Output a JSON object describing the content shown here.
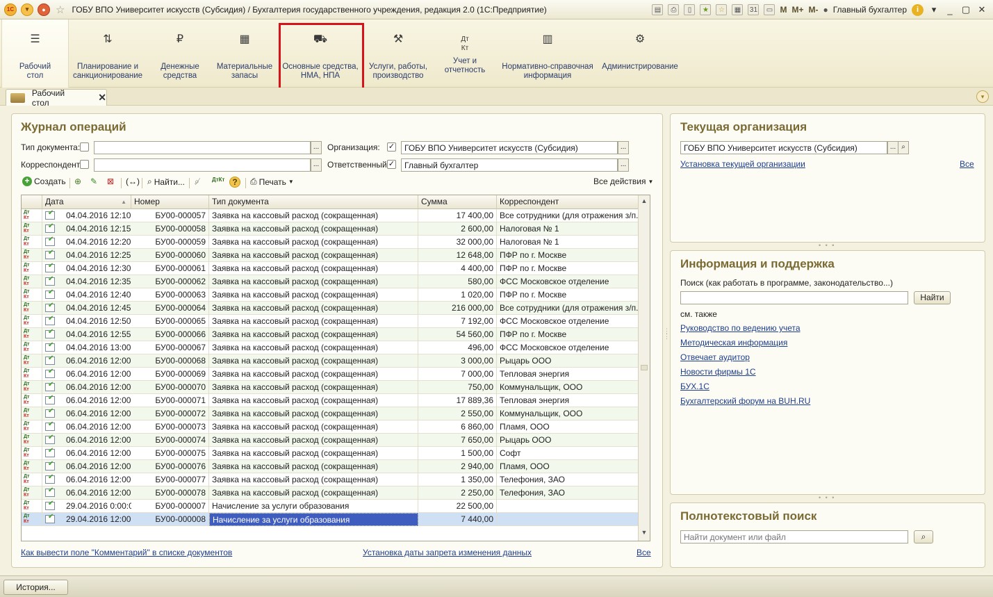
{
  "window": {
    "title": "ГОБУ ВПО Университет искусств (Субсидия) / Бухгалтерия государственного учреждения, редакция 2.0  (1С:Предприятие)",
    "logo_text": "1С",
    "mem_m": "M",
    "mem_mplus": "M+",
    "mem_mminus": "M-",
    "user": "Главный бухгалтер",
    "calendar_day": "31"
  },
  "sections": [
    {
      "label": "Рабочий\nстол",
      "icon": "menu-icon"
    },
    {
      "label": "Планирование и\nсанкционирование",
      "icon": "planning-icon"
    },
    {
      "label": "Денежные\nсредства",
      "icon": "money-icon"
    },
    {
      "label": "Материальные\nзапасы",
      "icon": "grid-icon"
    },
    {
      "label": "Основные средства,\nНМА, НПА",
      "icon": "truck-icon"
    },
    {
      "label": "Услуги, работы,\nпроизводство",
      "icon": "tools-icon"
    },
    {
      "label": "Учет и\nотчетность",
      "icon": "dtkt-icon"
    },
    {
      "label": "Нормативно-справочная\nинформация",
      "icon": "books-icon"
    },
    {
      "label": "Администрирование",
      "icon": "gear-icon"
    }
  ],
  "tab": {
    "label": "Рабочий стол"
  },
  "journal": {
    "title": "Журнал операций",
    "doc_type_label": "Тип документа:",
    "doc_type_value": "",
    "correspondent_label": "Корреспондент:",
    "correspondent_value": "",
    "org_label": "Организация:",
    "org_value": "ГОБУ ВПО Университет искусств (Субсидия)",
    "resp_label": "Ответственный:",
    "resp_value": "Главный бухгалтер",
    "toolbar": {
      "create": "Создать",
      "find": "Найти...",
      "print": "Печать",
      "all_actions": "Все действия"
    },
    "columns": [
      "Дата",
      "Номер",
      "Тип документа",
      "Сумма",
      "Корреспондент"
    ],
    "rows": [
      [
        "04.04.2016 12:10:00",
        "БУ00-000057",
        "Заявка на кассовый расход (сокращенная)",
        "17 400,00",
        "Все сотрудники (для отражения з/п..."
      ],
      [
        "04.04.2016 12:15:00",
        "БУ00-000058",
        "Заявка на кассовый расход (сокращенная)",
        "2 600,00",
        "Налоговая № 1"
      ],
      [
        "04.04.2016 12:20:00",
        "БУ00-000059",
        "Заявка на кассовый расход (сокращенная)",
        "32 000,00",
        "Налоговая № 1"
      ],
      [
        "04.04.2016 12:25:00",
        "БУ00-000060",
        "Заявка на кассовый расход (сокращенная)",
        "12 648,00",
        "ПФР по г. Москве"
      ],
      [
        "04.04.2016 12:30:00",
        "БУ00-000061",
        "Заявка на кассовый расход (сокращенная)",
        "4 400,00",
        "ПФР по г. Москве"
      ],
      [
        "04.04.2016 12:35:00",
        "БУ00-000062",
        "Заявка на кассовый расход (сокращенная)",
        "580,00",
        "ФСС Московское отделение"
      ],
      [
        "04.04.2016 12:40:00",
        "БУ00-000063",
        "Заявка на кассовый расход (сокращенная)",
        "1 020,00",
        "ПФР по г. Москве"
      ],
      [
        "04.04.2016 12:45:00",
        "БУ00-000064",
        "Заявка на кассовый расход (сокращенная)",
        "216 000,00",
        "Все сотрудники (для отражения з/п..."
      ],
      [
        "04.04.2016 12:50:00",
        "БУ00-000065",
        "Заявка на кассовый расход (сокращенная)",
        "7 192,00",
        "ФСС Московское отделение"
      ],
      [
        "04.04.2016 12:55:00",
        "БУ00-000066",
        "Заявка на кассовый расход (сокращенная)",
        "54 560,00",
        "ПФР по г. Москве"
      ],
      [
        "04.04.2016 13:00:00",
        "БУ00-000067",
        "Заявка на кассовый расход (сокращенная)",
        "496,00",
        "ФСС Московское отделение"
      ],
      [
        "06.04.2016 12:00:00",
        "БУ00-000068",
        "Заявка на кассовый расход (сокращенная)",
        "3 000,00",
        "Рыцарь ООО"
      ],
      [
        "06.04.2016 12:00:01",
        "БУ00-000069",
        "Заявка на кассовый расход (сокращенная)",
        "7 000,00",
        "Тепловая энергия"
      ],
      [
        "06.04.2016 12:00:02",
        "БУ00-000070",
        "Заявка на кассовый расход (сокращенная)",
        "750,00",
        "Коммунальщик, ООО"
      ],
      [
        "06.04.2016 12:00:03",
        "БУ00-000071",
        "Заявка на кассовый расход (сокращенная)",
        "17 889,36",
        "Тепловая энергия"
      ],
      [
        "06.04.2016 12:00:04",
        "БУ00-000072",
        "Заявка на кассовый расход (сокращенная)",
        "2 550,00",
        "Коммунальщик, ООО"
      ],
      [
        "06.04.2016 12:00:05",
        "БУ00-000073",
        "Заявка на кассовый расход (сокращенная)",
        "6 860,00",
        "Пламя, ООО"
      ],
      [
        "06.04.2016 12:00:06",
        "БУ00-000074",
        "Заявка на кассовый расход (сокращенная)",
        "7 650,00",
        "Рыцарь ООО"
      ],
      [
        "06.04.2016 12:00:07",
        "БУ00-000075",
        "Заявка на кассовый расход (сокращенная)",
        "1 500,00",
        "Софт"
      ],
      [
        "06.04.2016 12:00:08",
        "БУ00-000076",
        "Заявка на кассовый расход (сокращенная)",
        "2 940,00",
        "Пламя, ООО"
      ],
      [
        "06.04.2016 12:00:09",
        "БУ00-000077",
        "Заявка на кассовый расход (сокращенная)",
        "1 350,00",
        "Телефония, ЗАО"
      ],
      [
        "06.04.2016 12:00:10",
        "БУ00-000078",
        "Заявка на кассовый расход (сокращенная)",
        "2 250,00",
        "Телефония, ЗАО"
      ],
      [
        "29.04.2016 0:00:00",
        "БУ00-000007",
        "Начисление за услуги образования",
        "22 500,00",
        ""
      ],
      [
        "29.04.2016 12:00:00",
        "БУ00-000008",
        "Начисление за услуги образования",
        "7 440,00",
        ""
      ]
    ],
    "link_comment": "Как вывести поле \"Комментарий\" в списке документов",
    "link_date": "Установка даты запрета изменения данных",
    "link_all": "Все"
  },
  "org_panel": {
    "title": "Текущая организация",
    "value": "ГОБУ ВПО Университет искусств (Субсидия)",
    "link_set": "Установка текущей организации",
    "link_all": "Все"
  },
  "info_panel": {
    "title": "Информация и поддержка",
    "search_label": "Поиск (как работать в программе, законодательство...)",
    "search_value": "",
    "find_button": "Найти",
    "see_also": "см. также",
    "links": [
      "Руководство по ведению учета",
      "Методическая информация",
      "Отвечает аудитор",
      "Новости фирмы 1С",
      "БУХ.1С",
      "Бухгалтерский форум на BUH.RU"
    ]
  },
  "fts_panel": {
    "title": "Полнотекстовый поиск",
    "placeholder": "Найти документ или файл"
  },
  "status": {
    "history_button": "История..."
  }
}
